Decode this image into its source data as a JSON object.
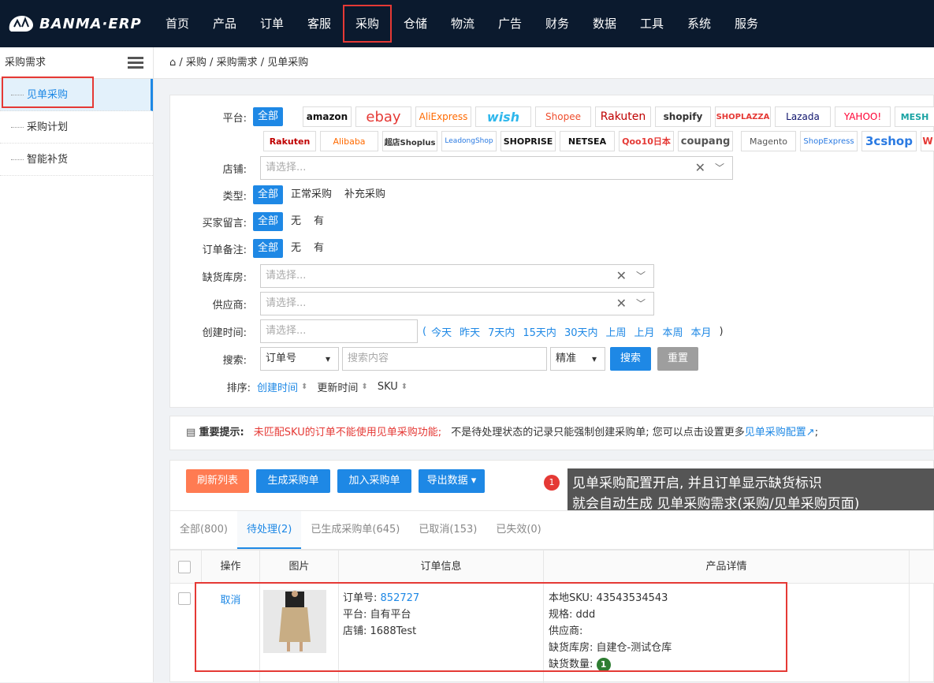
{
  "app": {
    "logo_text": "BANMA·ERP"
  },
  "nav": [
    "首页",
    "产品",
    "订单",
    "客服",
    "采购",
    "仓储",
    "物流",
    "广告",
    "财务",
    "数据",
    "工具",
    "系统",
    "服务"
  ],
  "sidebar": {
    "title": "采购需求",
    "items": [
      "见单采购",
      "采购计划",
      "智能补货"
    ]
  },
  "breadcrumb": "/ 采购 / 采购需求 / 见单采购",
  "filters": {
    "platform_label": "平台:",
    "platform_all": "全部",
    "platforms_row1": [
      "amazon",
      "ebay",
      "AliExpress",
      "wish",
      "Shopee",
      "Rakuten",
      "shopify",
      "SHOPLAZZA",
      "Lazada",
      "YAHOO!",
      "MESH"
    ],
    "platforms_row2": [
      "Rakuten",
      "Alibaba",
      "超店Shoplus",
      "LeadongShop",
      "SHOPRISE",
      "NETSEA",
      "Qoo10日本",
      "coupang",
      "Magento",
      "ShopExpress",
      "3cshop",
      "W"
    ],
    "shop_label": "店铺:",
    "shop_placeholder": "请选择...",
    "type_label": "类型:",
    "type_options": [
      "全部",
      "正常采购",
      "补充采购"
    ],
    "buyer_msg_label": "买家留言:",
    "buyer_msg_options": [
      "全部",
      "无",
      "有"
    ],
    "order_note_label": "订单备注:",
    "order_note_options": [
      "全部",
      "无",
      "有"
    ],
    "warehouse_label": "缺货库房:",
    "warehouse_placeholder": "请选择...",
    "supplier_label": "供应商:",
    "supplier_placeholder": "请选择...",
    "created_label": "创建时间:",
    "created_placeholder": "请选择...",
    "quick_dates": [
      "今天",
      "昨天",
      "7天内",
      "15天内",
      "30天内",
      "上周",
      "上月",
      "本周",
      "本月"
    ],
    "search_label": "搜索:",
    "search_field": "订单号",
    "search_placeholder": "搜索内容",
    "search_mode": "精准",
    "search_button": "搜索",
    "reset_button": "重置",
    "sort_label": "排序:",
    "sort_options": [
      "创建时间",
      "更新时间",
      "SKU"
    ]
  },
  "tip": {
    "title": "重要提示:",
    "red_text": "未匹配SKU的订单不能使用见单采购功能;",
    "text": "不是待处理状态的记录只能强制创建采购单; 您可以点击设置更多",
    "link": "见单采购配置",
    "end": ";"
  },
  "actions": [
    "刷新列表",
    "生成采购单",
    "加入采购单",
    "导出数据 ▾"
  ],
  "tooltip": {
    "badge": "1",
    "line1": "见单采购配置开启, 并且订单显示缺货标识",
    "line2": "就会自动生成 见单采购需求(采购/见单采购页面)"
  },
  "tabs": [
    "全部(800)",
    "待处理(2)",
    "已生成采购单(645)",
    "已取消(153)",
    "已失效(0)"
  ],
  "table": {
    "headers": [
      "操作",
      "图片",
      "订单信息",
      "产品详情"
    ],
    "row": {
      "action": "取消",
      "order_no_label": "订单号:",
      "order_no": "852727",
      "platform": "平台: 自有平台",
      "shop": "店铺: 1688Test",
      "local_sku": "本地SKU: 43543534543",
      "spec": "规格: ddd",
      "supplier": "供应商:",
      "warehouse": "缺货库房: 自建仓-测试仓库",
      "shortage_label": "缺货数量:",
      "shortage": "1"
    }
  }
}
